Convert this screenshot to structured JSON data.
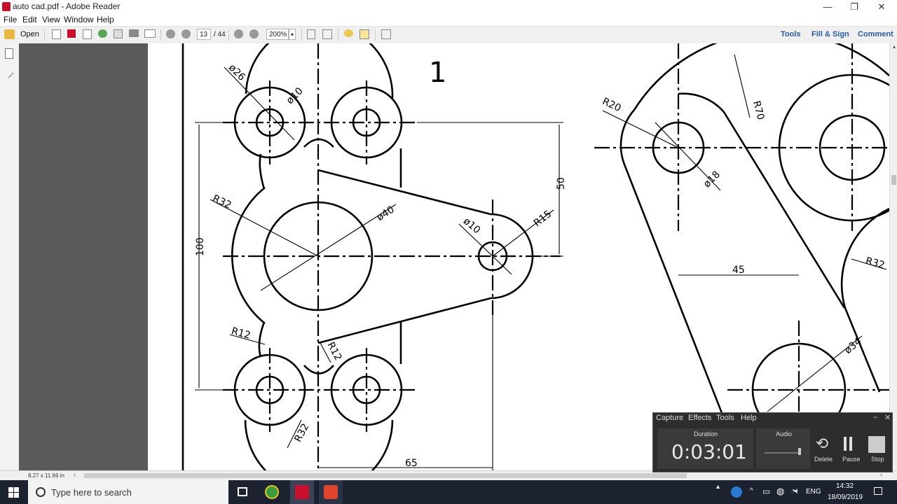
{
  "window": {
    "title": "auto cad.pdf - Adobe Reader",
    "controls": {
      "minimize": "—",
      "restore": "❐",
      "close": "✕"
    }
  },
  "menu": [
    "File",
    "Edit",
    "View",
    "Window",
    "Help"
  ],
  "toolbar": {
    "open_label": "Open",
    "page_current": "13",
    "page_total": "/ 44",
    "zoom": "200%",
    "tools_label": "Tools",
    "fill_sign_label": "Fill & Sign",
    "comment_label": "Comment"
  },
  "status": {
    "page_size": "8.27 x 11.69 in"
  },
  "drawing": {
    "sheet_number": "1",
    "dims": {
      "d26": "ø26",
      "d10_top": "ø10",
      "d40": "ø40",
      "d10_right": "ø10",
      "r32_left": "R32",
      "r15": "R15",
      "r12_left": "R12",
      "r12_mid": "R12",
      "r32_bottom": "R32",
      "dim100": "100",
      "dim50": "50",
      "dim65": "65"
    },
    "right_dims": {
      "r20": "R20",
      "r70": "R70",
      "d18": "ø18",
      "dim45": "45",
      "r32": "R32",
      "d34": "ø34"
    }
  },
  "recorder": {
    "menu": [
      "Capture",
      "Effects",
      "Tools",
      "Help"
    ],
    "duration_label": "Duration",
    "audio_label": "Audio",
    "time": "0:03:01",
    "delete_label": "Delete",
    "pause_label": "Pause",
    "stop_label": "Stop"
  },
  "taskbar": {
    "search_placeholder": "Type here to search",
    "lang": "ENG",
    "time": "14:32",
    "date": "18/09/2019"
  }
}
